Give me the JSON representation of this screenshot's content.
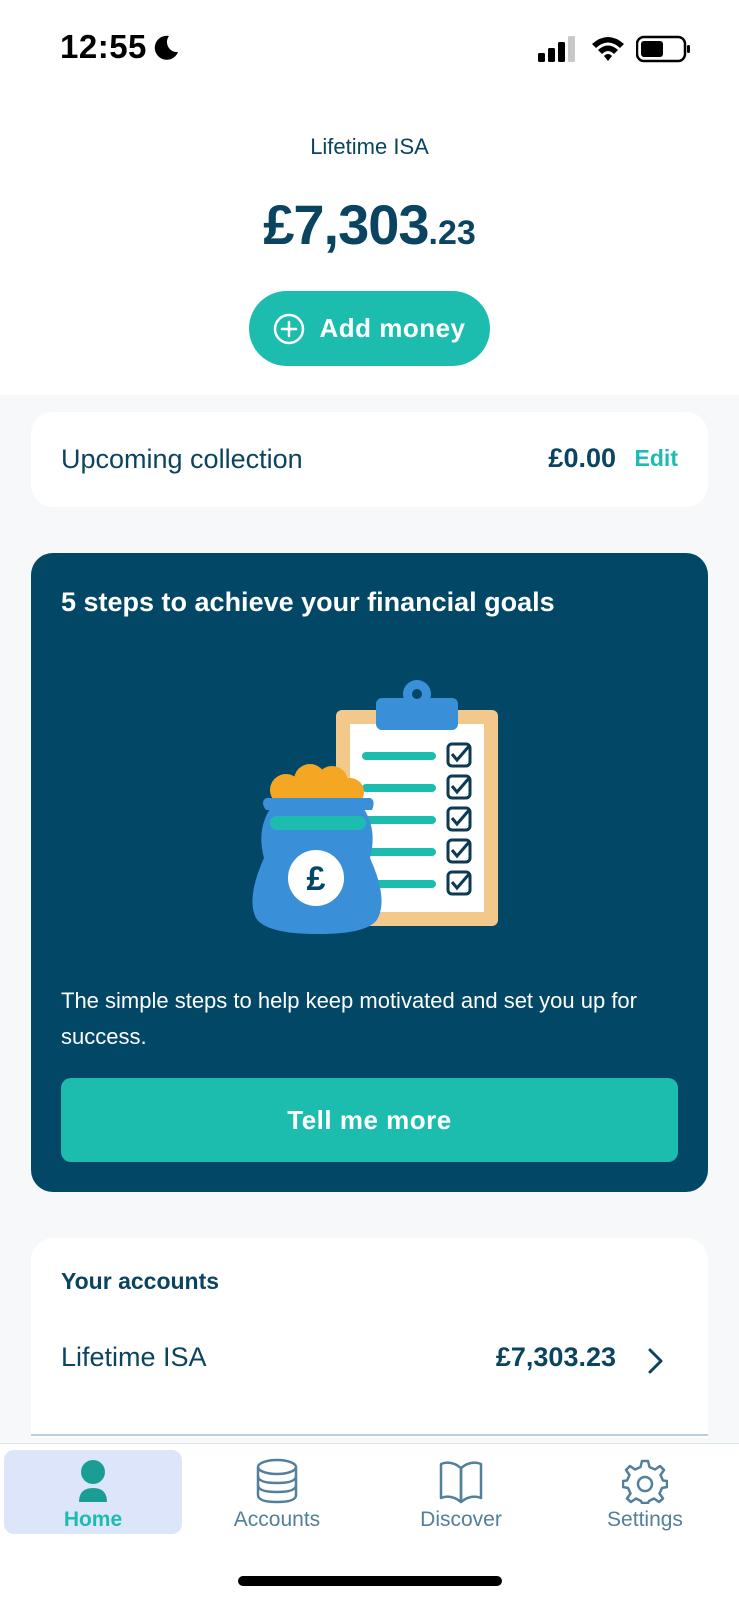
{
  "status_bar": {
    "time": "12:55"
  },
  "header": {
    "account_name": "Lifetime ISA",
    "balance_major": "£7,303",
    "balance_minor": ".23",
    "add_money_label": "Add money"
  },
  "collection": {
    "label": "Upcoming collection",
    "amount": "£0.00",
    "edit_label": "Edit"
  },
  "promo": {
    "title": "5 steps to achieve your financial goals",
    "text": "The simple steps to help keep motivated and set you up for success.",
    "button_label": "Tell me more"
  },
  "accounts": {
    "heading": "Your accounts",
    "items": [
      {
        "name": "Lifetime ISA",
        "amount": "£7,303.23"
      }
    ]
  },
  "nav": {
    "items": [
      {
        "label": "Home",
        "icon": "person-icon",
        "active": true
      },
      {
        "label": "Accounts",
        "icon": "database-icon",
        "active": false
      },
      {
        "label": "Discover",
        "icon": "book-icon",
        "active": false
      },
      {
        "label": "Settings",
        "icon": "gear-icon",
        "active": false
      }
    ]
  },
  "colors": {
    "accent": "#1cbdaf",
    "navy": "#0b4461",
    "promo_bg": "#024866",
    "nav_active_bg": "#dde5fb"
  }
}
